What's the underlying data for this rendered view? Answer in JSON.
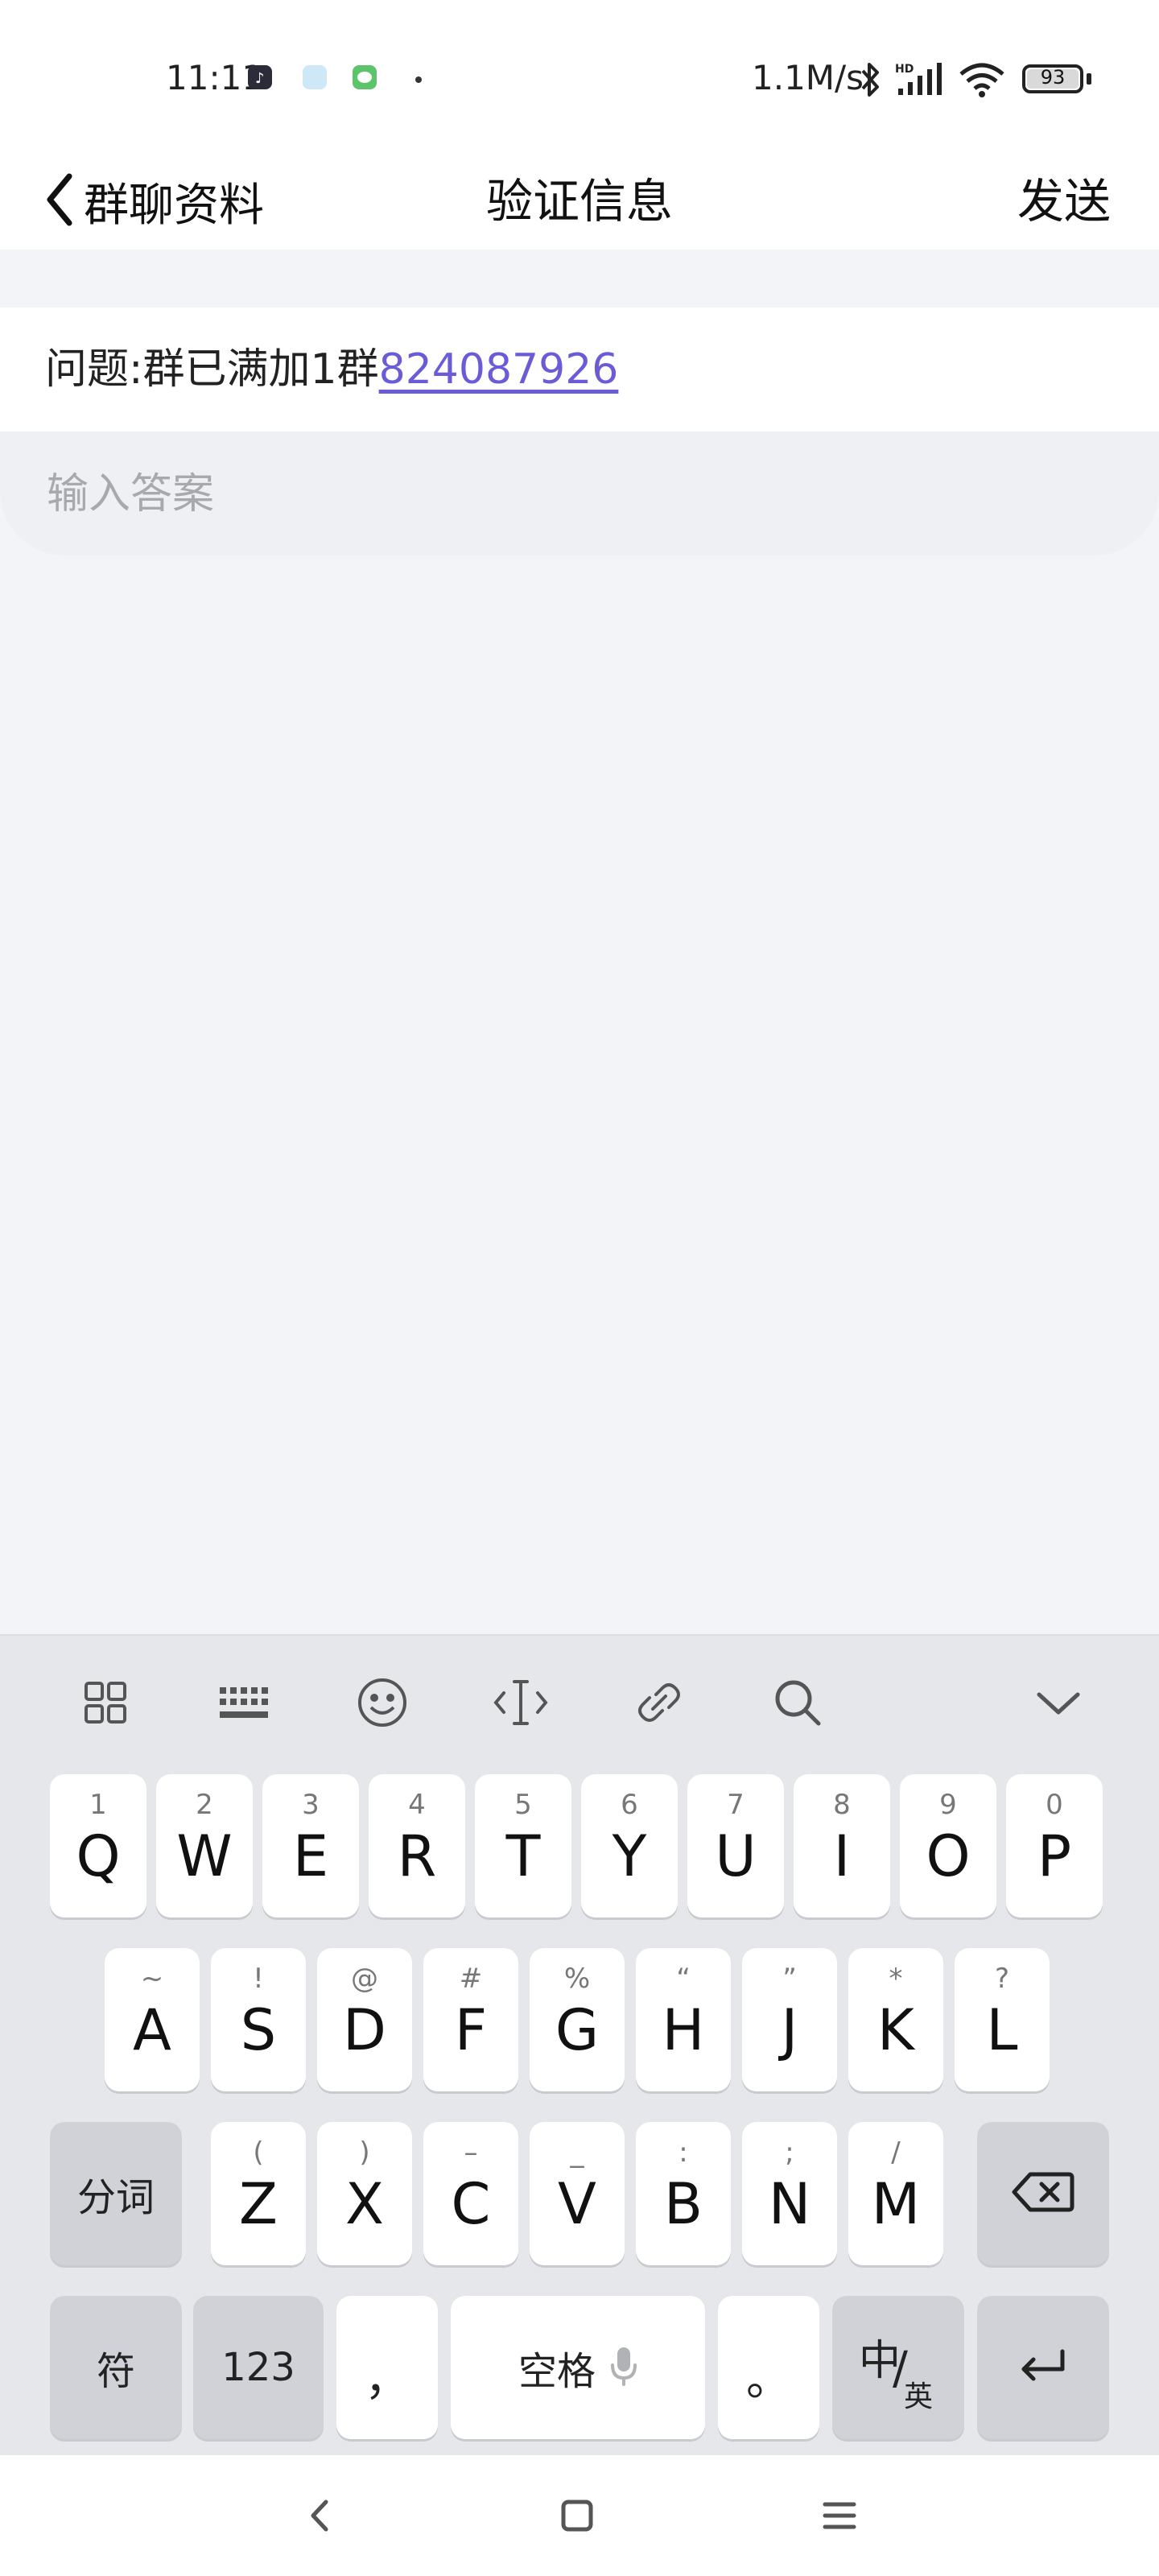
{
  "status_bar": {
    "time": "11:11",
    "network_speed": "1.1M/s",
    "battery_level": "93",
    "icons": [
      "tiktok-icon",
      "calendar-icon",
      "wechat-icon",
      "bluetooth-icon",
      "hd-signal-icon",
      "wifi-icon"
    ]
  },
  "title_bar": {
    "back_label": "群聊资料",
    "title": "验证信息",
    "send_label": "发送"
  },
  "question": {
    "prefix": "问题:群已满加1群",
    "link_text": "824087926"
  },
  "answer": {
    "placeholder": "输入答案",
    "value": ""
  },
  "keyboard": {
    "toolbar": [
      "grid-icon",
      "keyboard-icon",
      "emoji-icon",
      "cursor-icon",
      "link-icon",
      "search-icon",
      "collapse-icon"
    ],
    "row1": [
      {
        "main": "Q",
        "sub": "1"
      },
      {
        "main": "W",
        "sub": "2"
      },
      {
        "main": "E",
        "sub": "3"
      },
      {
        "main": "R",
        "sub": "4"
      },
      {
        "main": "T",
        "sub": "5"
      },
      {
        "main": "Y",
        "sub": "6"
      },
      {
        "main": "U",
        "sub": "7"
      },
      {
        "main": "I",
        "sub": "8"
      },
      {
        "main": "O",
        "sub": "9"
      },
      {
        "main": "P",
        "sub": "0"
      }
    ],
    "row2": [
      {
        "main": "A",
        "sub": "~"
      },
      {
        "main": "S",
        "sub": "!"
      },
      {
        "main": "D",
        "sub": "@"
      },
      {
        "main": "F",
        "sub": "#"
      },
      {
        "main": "G",
        "sub": "%"
      },
      {
        "main": "H",
        "sub": "“"
      },
      {
        "main": "J",
        "sub": "”"
      },
      {
        "main": "K",
        "sub": "*"
      },
      {
        "main": "L",
        "sub": "?"
      }
    ],
    "row3": [
      {
        "main": "Z",
        "sub": "("
      },
      {
        "main": "X",
        "sub": ")"
      },
      {
        "main": "C",
        "sub": "–"
      },
      {
        "main": "V",
        "sub": "_"
      },
      {
        "main": "B",
        "sub": ":"
      },
      {
        "main": "N",
        "sub": ";"
      },
      {
        "main": "M",
        "sub": "/"
      }
    ],
    "segment_label": "分词",
    "symbol_label": "符",
    "number_label": "123",
    "comma_label": "，",
    "space_label": "空格",
    "period_label": "。",
    "lang_main": "中",
    "lang_sub": "英"
  }
}
